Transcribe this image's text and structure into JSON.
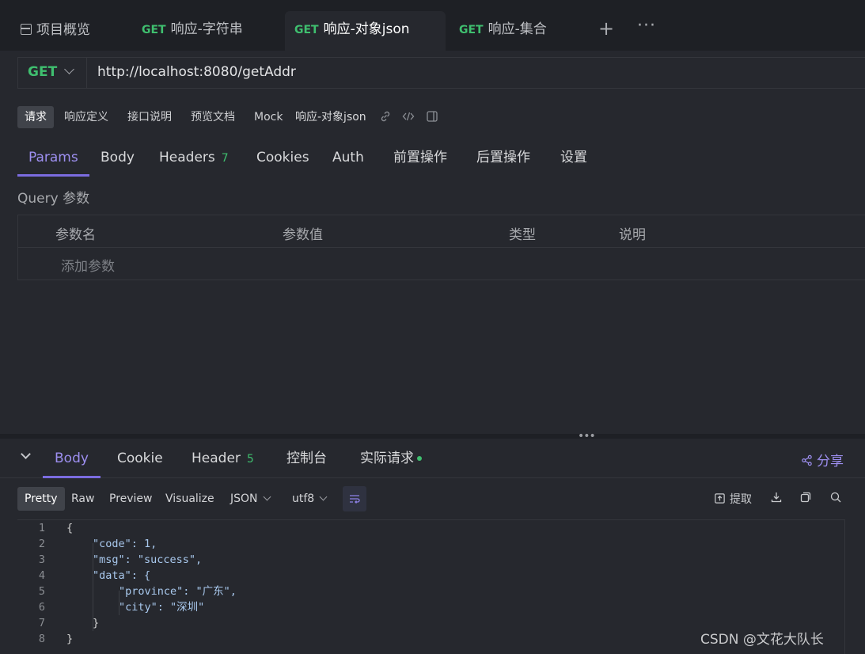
{
  "tabs": [
    {
      "method": "",
      "label": "项目概览"
    },
    {
      "method": "GET",
      "label": "响应-字符串"
    },
    {
      "method": "GET",
      "label": "响应-对象json"
    },
    {
      "method": "GET",
      "label": "响应-集合"
    }
  ],
  "tab_icons": {
    "add": "+",
    "more": "···"
  },
  "request": {
    "method": "GET",
    "url": "http://localhost:8080/getAddr"
  },
  "subbar": {
    "buttons": [
      "请求",
      "响应定义",
      "接口说明",
      "预览文档",
      "Mock"
    ],
    "doc_name": "响应-对象json"
  },
  "req_tabs": {
    "params": "Params",
    "body": "Body",
    "headers": "Headers",
    "headers_count": "7",
    "cookies": "Cookies",
    "auth": "Auth",
    "pre": "前置操作",
    "post": "后置操作",
    "settings": "设置"
  },
  "query": {
    "label": "Query 参数",
    "columns": [
      "参数名",
      "参数值",
      "类型",
      "说明"
    ],
    "add_placeholder": "添加参数"
  },
  "response_tabs": {
    "body": "Body",
    "cookie": "Cookie",
    "header": "Header",
    "header_count": "5",
    "console": "控制台",
    "actual": "实际请求",
    "share": "分享"
  },
  "format": {
    "buttons": [
      "Pretty",
      "Raw",
      "Preview",
      "Visualize"
    ],
    "type": "JSON",
    "encoding": "utf8",
    "extract": "提取"
  },
  "code_lines": [
    {
      "n": "1",
      "text": "{"
    },
    {
      "n": "2",
      "text": "\"code\": 1,"
    },
    {
      "n": "3",
      "text": "\"msg\": \"success\","
    },
    {
      "n": "4",
      "text": "\"data\": {"
    },
    {
      "n": "5",
      "text": "\"province\": \"广东\","
    },
    {
      "n": "6",
      "text": "\"city\": \"深圳\""
    },
    {
      "n": "7",
      "text": "}"
    },
    {
      "n": "8",
      "text": "}"
    }
  ],
  "watermark": "CSDN @文花大队长",
  "colors": {
    "accent": "#7b6ce0",
    "get": "#3fbf6f",
    "background": "#26282e"
  }
}
